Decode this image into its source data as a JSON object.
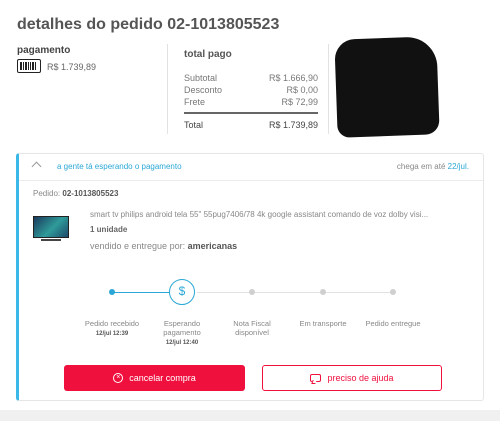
{
  "page": {
    "title": "detalhes do pedido 02-1013805523"
  },
  "payment": {
    "label": "pagamento",
    "method_icon": "barcode-icon",
    "amount": "R$ 1.739,89"
  },
  "totals": {
    "label": "total pago",
    "rows": [
      {
        "label": "Subtotal",
        "value": "R$ 1.666,90"
      },
      {
        "label": "Desconto",
        "value": "R$ 0,00"
      },
      {
        "label": "Frete",
        "value": "R$ 72,99"
      }
    ],
    "total": {
      "label": "Total",
      "value": "R$ 1.739,89"
    }
  },
  "order": {
    "status_text": "a gente tá esperando o pagamento",
    "arrival_prefix": "chega em até",
    "arrival_date": "22/jul.",
    "order_label": "Pedido:",
    "order_number": "02-1013805523",
    "product": {
      "name": "smart tv philips android tela 55\" 55pug7406/78 4k google assistant comando de voz dolby visi...",
      "quantity": "1 unidade",
      "seller_prefix": "vendido e entregue por:",
      "seller": "americanas"
    },
    "tracking": {
      "current_step_index": 1,
      "current_icon_glyph": "$",
      "steps": [
        {
          "label": "Pedido recebido",
          "time": "12/jul 12:39",
          "status": "done"
        },
        {
          "label": "Esperando pagamento",
          "time": "12/jul 12:40",
          "status": "current"
        },
        {
          "label": "Nota Fiscal disponível",
          "time": "",
          "status": "pending"
        },
        {
          "label": "Em transporte",
          "time": "",
          "status": "pending"
        },
        {
          "label": "Pedido entregue",
          "time": "",
          "status": "pending"
        }
      ]
    },
    "actions": {
      "cancel_label": "cancelar compra",
      "help_label": "preciso de ajuda"
    }
  },
  "colors": {
    "accent_blue": "#2aa7d6",
    "accent_red": "#f0103e"
  }
}
